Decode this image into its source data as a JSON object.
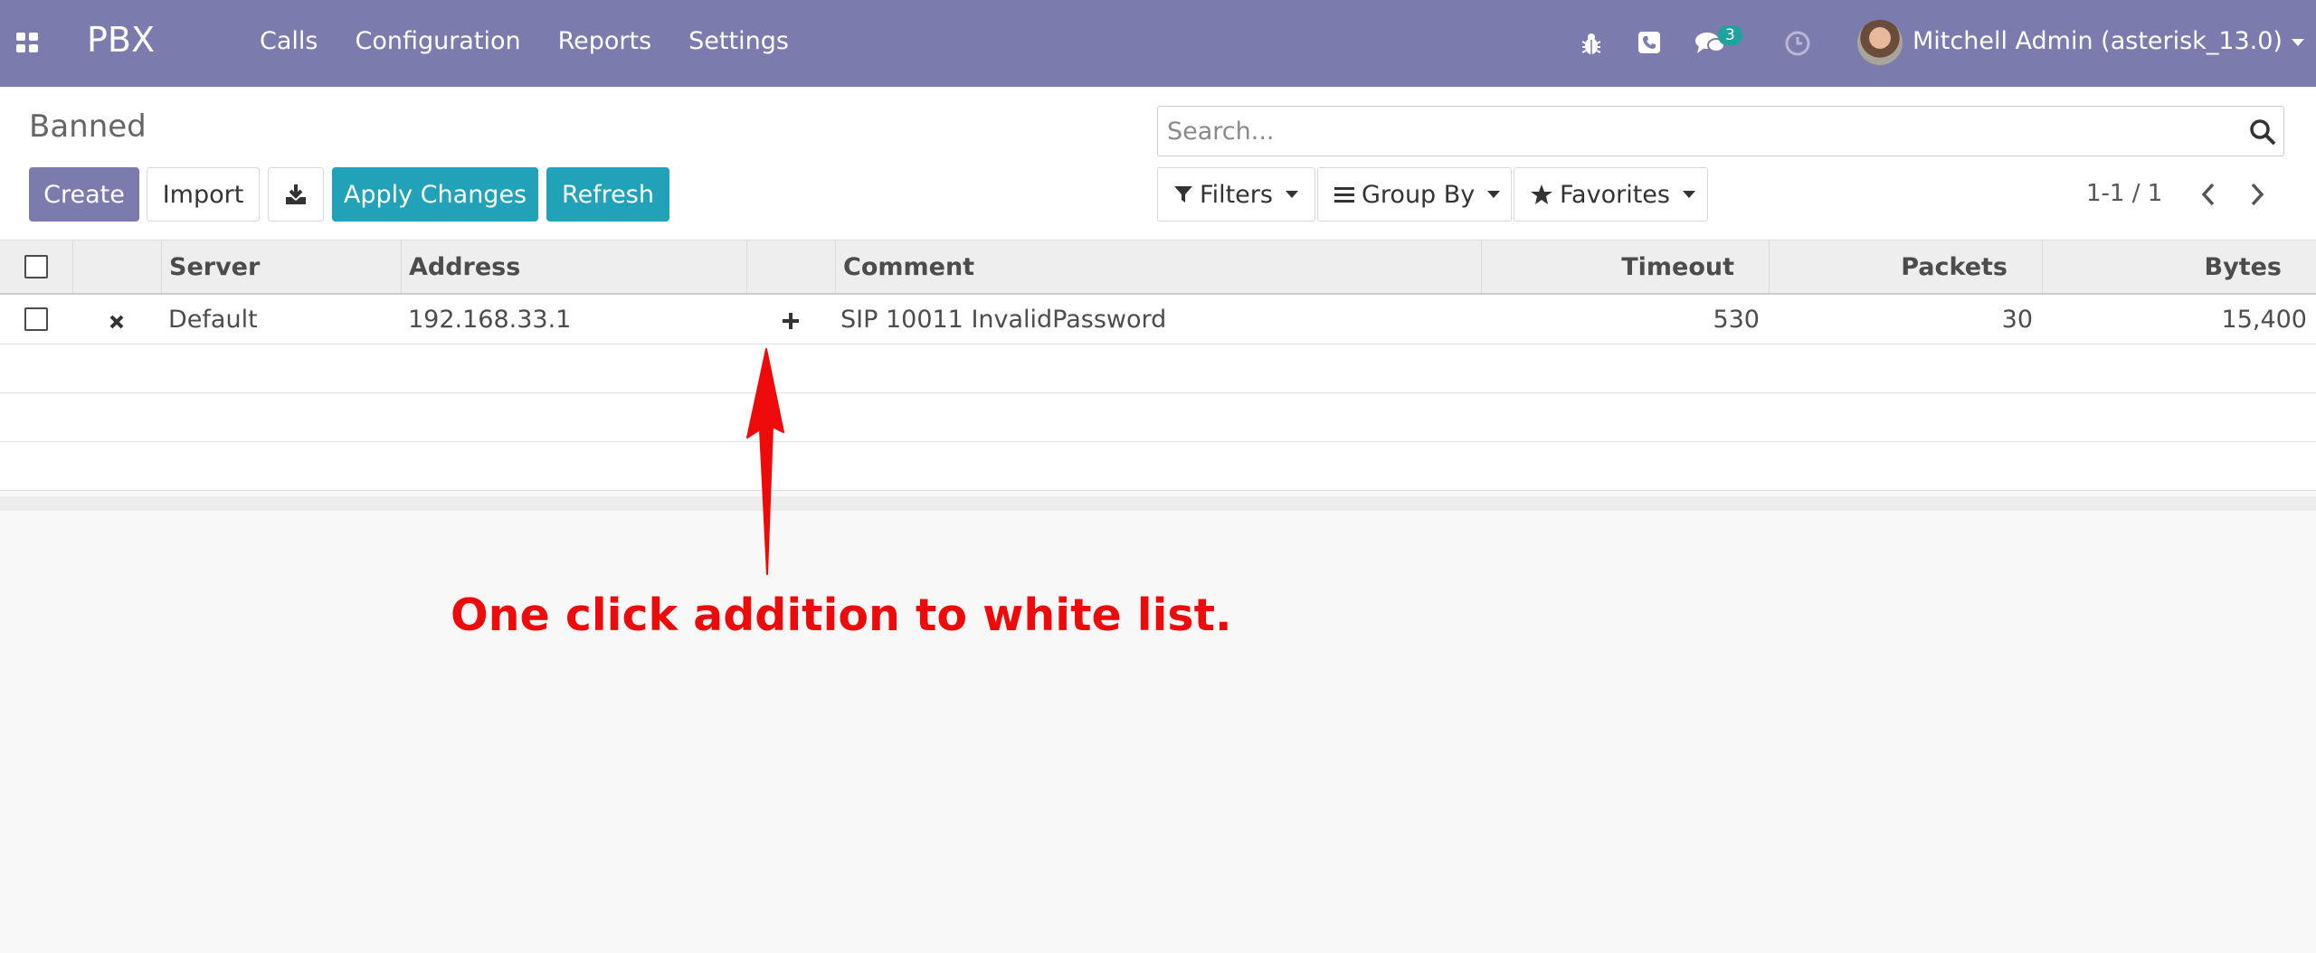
{
  "navbar": {
    "brand": "PBX",
    "menu": [
      "Calls",
      "Configuration",
      "Reports",
      "Settings"
    ],
    "icons": [
      "apps-icon",
      "bug-icon",
      "phone-icon",
      "chat-icon",
      "clock-icon"
    ],
    "messages_count": "3",
    "user": "Mitchell Admin (asterisk_13.0)"
  },
  "breadcrumb": "Banned",
  "buttons": {
    "create": "Create",
    "import": "Import",
    "apply": "Apply Changes",
    "refresh": "Refresh"
  },
  "search": {
    "placeholder": "Search..."
  },
  "filters": {
    "filters": "Filters",
    "group_by": "Group By",
    "favorites": "Favorites"
  },
  "pager": "1-1 / 1",
  "table": {
    "columns": [
      "Server",
      "Address",
      "Comment",
      "Timeout",
      "Packets",
      "Bytes"
    ],
    "rows": [
      {
        "server": "Default",
        "address": "192.168.33.1",
        "comment": "SIP 10011 InvalidPassword",
        "timeout": "530",
        "packets": "30",
        "bytes": "15,400"
      }
    ]
  },
  "annotation": "One click addition to white list.",
  "colors": {
    "navbar": "#7c7bad",
    "primary": "#7c7bad",
    "info": "#21a2b8",
    "annotation": "#ee0a0a",
    "badge": "#20a29e"
  }
}
